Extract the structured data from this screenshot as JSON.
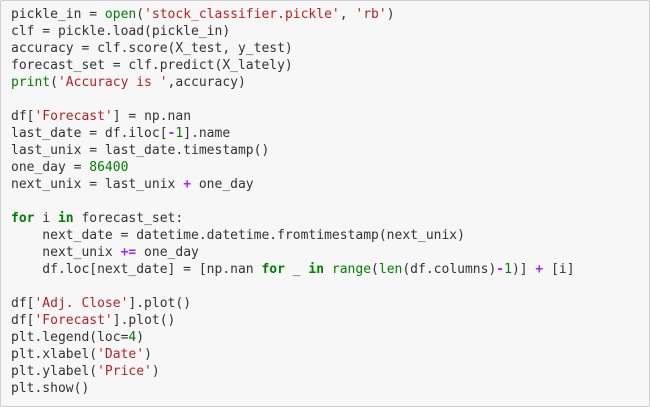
{
  "lines": [
    [
      {
        "t": "pickle_in = ",
        "c": "plain"
      },
      {
        "t": "open",
        "c": "bi"
      },
      {
        "t": "(",
        "c": "plain"
      },
      {
        "t": "'stock_classifier.pickle'",
        "c": "str"
      },
      {
        "t": ", ",
        "c": "plain"
      },
      {
        "t": "'rb'",
        "c": "str"
      },
      {
        "t": ")",
        "c": "plain"
      }
    ],
    [
      {
        "t": "clf = pickle.load(pickle_in)",
        "c": "plain"
      }
    ],
    [
      {
        "t": "accuracy = clf.score(X_test, y_test)",
        "c": "plain"
      }
    ],
    [
      {
        "t": "forecast_set = clf.predict(X_lately)",
        "c": "plain"
      }
    ],
    [
      {
        "t": "print",
        "c": "bi"
      },
      {
        "t": "(",
        "c": "plain"
      },
      {
        "t": "'Accuracy is '",
        "c": "str"
      },
      {
        "t": ",accuracy)",
        "c": "plain"
      }
    ],
    [],
    [
      {
        "t": "df[",
        "c": "plain"
      },
      {
        "t": "'Forecast'",
        "c": "str"
      },
      {
        "t": "] = np.nan",
        "c": "plain"
      }
    ],
    [
      {
        "t": "last_date = df.iloc[",
        "c": "plain"
      },
      {
        "t": "-",
        "c": "op"
      },
      {
        "t": "1",
        "c": "num"
      },
      {
        "t": "].name",
        "c": "plain"
      }
    ],
    [
      {
        "t": "last_unix = last_date.timestamp()",
        "c": "plain"
      }
    ],
    [
      {
        "t": "one_day = ",
        "c": "plain"
      },
      {
        "t": "86400",
        "c": "num"
      }
    ],
    [
      {
        "t": "next_unix = last_unix ",
        "c": "plain"
      },
      {
        "t": "+",
        "c": "op"
      },
      {
        "t": " one_day",
        "c": "plain"
      }
    ],
    [],
    [
      {
        "t": "for",
        "c": "kw"
      },
      {
        "t": " i ",
        "c": "plain"
      },
      {
        "t": "in",
        "c": "kw"
      },
      {
        "t": " forecast_set:",
        "c": "plain"
      }
    ],
    [
      {
        "t": "    next_date = datetime.datetime.fromtimestamp(next_unix)",
        "c": "plain"
      }
    ],
    [
      {
        "t": "    next_unix ",
        "c": "plain"
      },
      {
        "t": "+=",
        "c": "op"
      },
      {
        "t": " one_day",
        "c": "plain"
      }
    ],
    [
      {
        "t": "    df.loc[next_date] = [np.nan ",
        "c": "plain"
      },
      {
        "t": "for",
        "c": "kw"
      },
      {
        "t": " _ ",
        "c": "plain"
      },
      {
        "t": "in",
        "c": "kw"
      },
      {
        "t": " ",
        "c": "plain"
      },
      {
        "t": "range",
        "c": "bi"
      },
      {
        "t": "(",
        "c": "plain"
      },
      {
        "t": "len",
        "c": "bi"
      },
      {
        "t": "(df.columns)",
        "c": "plain"
      },
      {
        "t": "-",
        "c": "op"
      },
      {
        "t": "1",
        "c": "num"
      },
      {
        "t": ")] ",
        "c": "plain"
      },
      {
        "t": "+",
        "c": "op"
      },
      {
        "t": " [i]",
        "c": "plain"
      }
    ],
    [],
    [
      {
        "t": "df[",
        "c": "plain"
      },
      {
        "t": "'Adj. Close'",
        "c": "str"
      },
      {
        "t": "].plot()",
        "c": "plain"
      }
    ],
    [
      {
        "t": "df[",
        "c": "plain"
      },
      {
        "t": "'Forecast'",
        "c": "str"
      },
      {
        "t": "].plot()",
        "c": "plain"
      }
    ],
    [
      {
        "t": "plt.legend(loc=",
        "c": "plain"
      },
      {
        "t": "4",
        "c": "num"
      },
      {
        "t": ")",
        "c": "plain"
      }
    ],
    [
      {
        "t": "plt.xlabel(",
        "c": "plain"
      },
      {
        "t": "'Date'",
        "c": "str"
      },
      {
        "t": ")",
        "c": "plain"
      }
    ],
    [
      {
        "t": "plt.ylabel(",
        "c": "plain"
      },
      {
        "t": "'Price'",
        "c": "str"
      },
      {
        "t": ")",
        "c": "plain"
      }
    ],
    [
      {
        "t": "plt.show()",
        "c": "plain"
      }
    ]
  ],
  "colors": {
    "cell_background": "#f7f7f7",
    "cell_border": "#cfcfcf",
    "text": "#333333",
    "keyword": "#008000",
    "string": "#ba2121",
    "number": "#008000",
    "operator": "#aa22ff"
  }
}
